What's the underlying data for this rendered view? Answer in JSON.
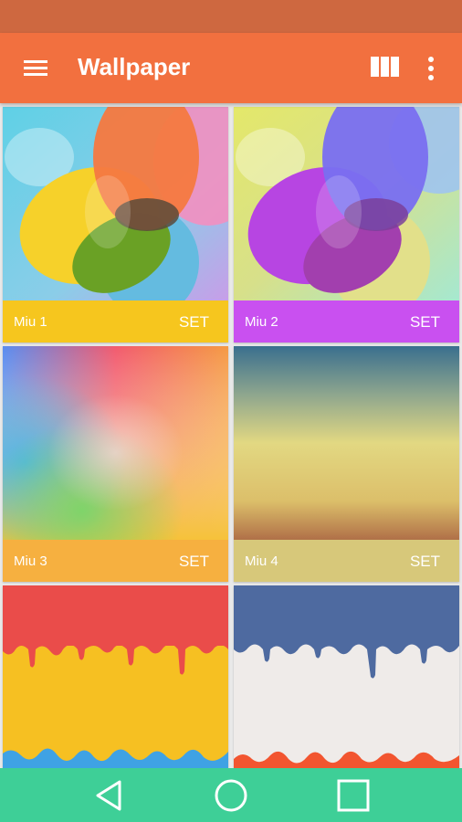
{
  "app_bar": {
    "title": "Wallpaper",
    "menu_icon": "hamburger-menu-icon",
    "view_icon": "column-grid-icon",
    "overflow_icon": "more-vert-icon"
  },
  "colors": {
    "status_bar": "#ce6840",
    "app_bar": "#f2703f",
    "nav_bar": "#3ecf97",
    "background": "#e9e9e9"
  },
  "wallpapers": [
    {
      "name": "Miu 1",
      "action": "SET",
      "footer_color": "#f6c61e"
    },
    {
      "name": "Miu 2",
      "action": "SET",
      "footer_color": "#c950f0"
    },
    {
      "name": "Miu 3",
      "action": "SET",
      "footer_color": "#f6b040"
    },
    {
      "name": "Miu 4",
      "action": "SET",
      "footer_color": "#d7c87a"
    },
    {
      "name": "",
      "action": "",
      "footer_color": "#f6c022"
    },
    {
      "name": "",
      "action": "",
      "footer_color": "#f25530"
    }
  ],
  "nav_bar": {
    "back_icon": "back-triangle-icon",
    "home_icon": "home-circle-icon",
    "recents_icon": "recents-square-icon"
  }
}
